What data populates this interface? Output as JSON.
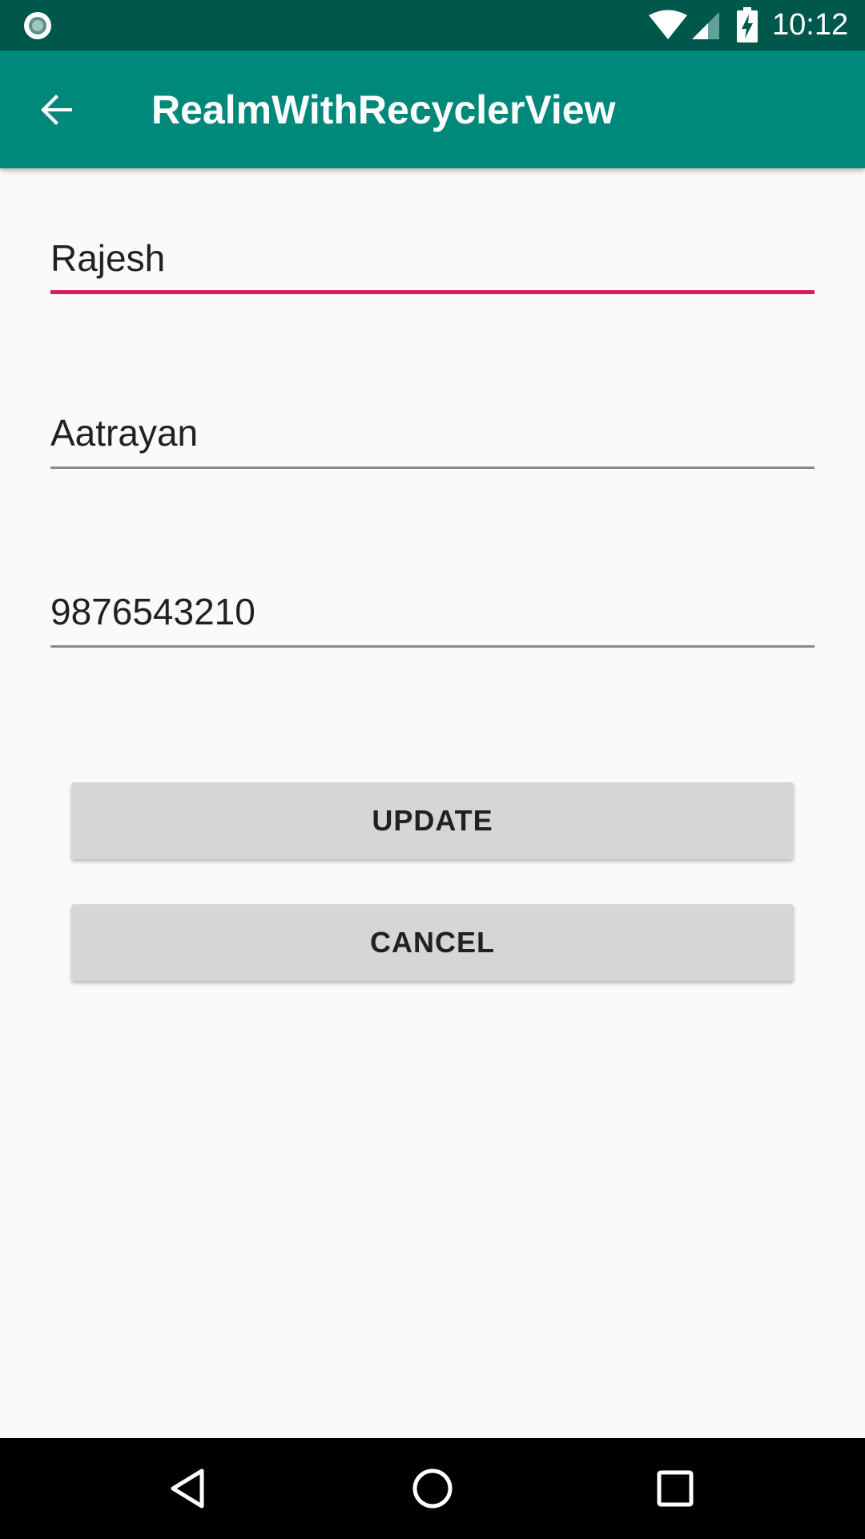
{
  "status_bar": {
    "time": "10:12",
    "icons": [
      "notification-circle-icon",
      "wifi-icon",
      "cell-signal-icon",
      "battery-charging-icon"
    ]
  },
  "app_bar": {
    "title": "RealmWithRecyclerView",
    "back_icon": "arrow-back-icon"
  },
  "form": {
    "first_name": {
      "value": "Rajesh",
      "focused": true
    },
    "last_name": {
      "value": "Aatrayan"
    },
    "phone": {
      "value": "9876543210"
    }
  },
  "buttons": {
    "update_label": "UPDATE",
    "cancel_label": "CANCEL"
  },
  "nav_bar": {
    "icons": [
      "nav-back-icon",
      "nav-home-icon",
      "nav-recents-icon"
    ]
  },
  "colors": {
    "status_bar": "#00574b",
    "app_bar": "#00897b",
    "accent": "#d81b60",
    "background": "#fafafa",
    "button": "#d6d6d6"
  }
}
